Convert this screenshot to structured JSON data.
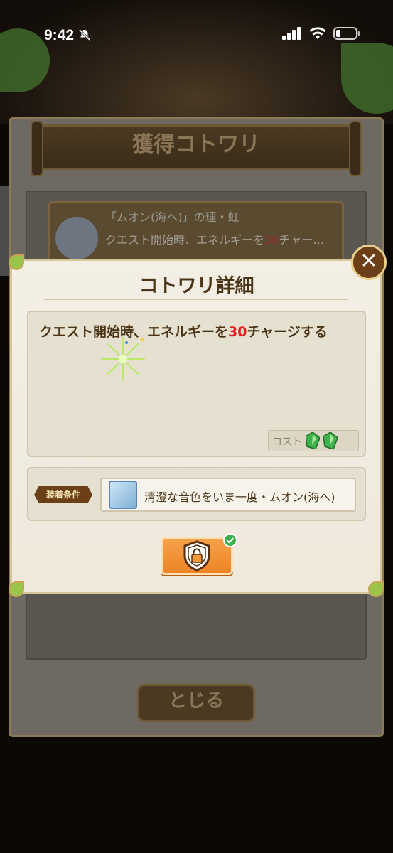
{
  "status_bar": {
    "time": "9:42"
  },
  "side_tab": {
    "glyph": "❯"
  },
  "background_screen": {
    "title": "獲得コトワリ",
    "card_name": "「ムオン(海へ)」の理・虹",
    "card_desc_prefix": "クエスト開始時、エネルギーを",
    "card_desc_value": "30",
    "card_desc_suffix": "チャー…",
    "close_label": "とじる"
  },
  "modal": {
    "title": "コトワリ詳細",
    "close_glyph": "✕",
    "description_prefix": "クエスト開始時、エネルギーを",
    "description_value": "30",
    "description_suffix": "チャージする",
    "cost_label": "コスト",
    "cost_count": 2,
    "condition_tag": "装着条件",
    "condition_text": "清澄な音色をいま一度・ムオン(海へ)",
    "lock_state": "locked"
  },
  "colors": {
    "accent_orange": "#ec8426",
    "highlight_red": "#e02020",
    "brown": "#6b3f18",
    "check_green": "#3cb04b"
  }
}
